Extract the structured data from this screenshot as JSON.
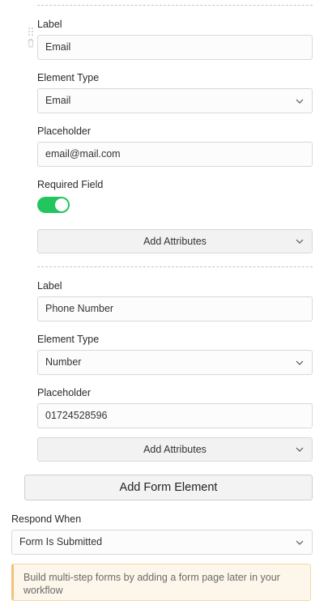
{
  "form_elements": [
    {
      "label_heading": "Label",
      "label_value": "Email",
      "type_heading": "Element Type",
      "type_value": "Email",
      "placeholder_heading": "Placeholder",
      "placeholder_value": "email@mail.com",
      "required_heading": "Required Field",
      "required": true,
      "add_attributes_label": "Add Attributes"
    },
    {
      "label_heading": "Label",
      "label_value": "Phone Number",
      "type_heading": "Element Type",
      "type_value": "Number",
      "placeholder_heading": "Placeholder",
      "placeholder_value": "01724528596",
      "add_attributes_label": "Add Attributes"
    }
  ],
  "add_form_element_label": "Add Form Element",
  "respond_when": {
    "heading": "Respond When",
    "value": "Form Is Submitted"
  },
  "notice": {
    "text": "Build multi-step forms by adding a form page later in your workflow"
  },
  "colors": {
    "toggle_on": "#22c55e",
    "notice_bg": "#fdf6ea",
    "notice_border": "#f5c27a"
  },
  "icons": [
    "drag-handle-icon",
    "trash-icon",
    "chevron-down-icon"
  ]
}
